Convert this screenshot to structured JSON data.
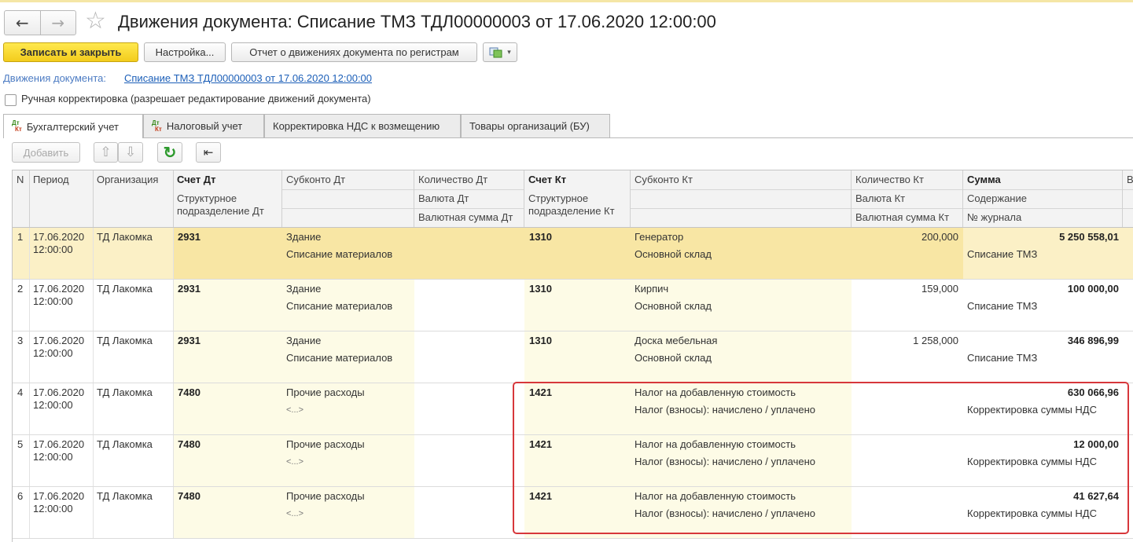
{
  "window": {
    "title": "Движения документа: Списание ТМЗ ТДЛ00000003 от 17.06.2020 12:00:00",
    "back_icon": "←",
    "forward_icon": "→",
    "star_icon": "☆"
  },
  "toolbar": {
    "save_close": "Записать и закрыть",
    "settings": "Настройка...",
    "report": "Отчет о движениях документа по регистрам",
    "more_icon": "▾"
  },
  "doc": {
    "label": "Движения документа:",
    "link": "Списание ТМЗ ТДЛ00000003 от 17.06.2020 12:00:00"
  },
  "manual": {
    "label": "Ручная корректировка (разрешает редактирование движений документа)",
    "checked": false
  },
  "tabs": [
    {
      "label": "Бухгалтерский учет",
      "icon_top": "Дт",
      "icon_bottom": "Кт",
      "active": true
    },
    {
      "label": "Налоговый учет",
      "icon_top": "Дт",
      "icon_bottom": "Кт",
      "active": false
    },
    {
      "label": "Корректировка НДС к возмещению",
      "active": false
    },
    {
      "label": "Товары организаций (БУ)",
      "active": false
    }
  ],
  "table_toolbar": {
    "add": "Добавить",
    "up_icon": "⇧",
    "down_icon": "⇩",
    "refresh_icon": "↻",
    "register_icon": "⇤"
  },
  "columns": {
    "n": "N",
    "period": "Период",
    "org": "Организация",
    "acc_dt": "Счет Дт",
    "dept_dt": "Структурное подразделение Дт",
    "sub_dt": "Субконто Дт",
    "qty_dt": "Количество Дт",
    "cur_dt": "Валюта Дт",
    "cursum_dt": "Валютная сумма Дт",
    "acc_kt": "Счет Кт",
    "dept_kt": "Структурное подразделение Кт",
    "sub_kt": "Субконто Кт",
    "qty_kt": "Количество Кт",
    "cur_kt": "Валюта Кт",
    "cursum_kt": "Валютная сумма Кт",
    "sum": "Сумма",
    "content": "Содержание",
    "journal": "№ журнала",
    "extra": "В"
  },
  "rows": [
    {
      "n": "1",
      "date": "17.06.2020",
      "time": "12:00:00",
      "org": "ТД Лакомка",
      "acc_dt": "2931",
      "sub_dt_1": "Здание",
      "sub_dt_2": "Списание материалов",
      "acc_kt": "1310",
      "sub_kt_1": "Генератор",
      "sub_kt_2": "Основной склад",
      "qty_kt": "200,000",
      "sum": "5 250 558,01",
      "content": "Списание ТМЗ"
    },
    {
      "n": "2",
      "date": "17.06.2020",
      "time": "12:00:00",
      "org": "ТД Лакомка",
      "acc_dt": "2931",
      "sub_dt_1": "Здание",
      "sub_dt_2": "Списание материалов",
      "acc_kt": "1310",
      "sub_kt_1": "Кирпич",
      "sub_kt_2": "Основной склад",
      "qty_kt": "159,000",
      "sum": "100 000,00",
      "content": "Списание ТМЗ"
    },
    {
      "n": "3",
      "date": "17.06.2020",
      "time": "12:00:00",
      "org": "ТД Лакомка",
      "acc_dt": "2931",
      "sub_dt_1": "Здание",
      "sub_dt_2": "Списание материалов",
      "acc_kt": "1310",
      "sub_kt_1": "Доска мебельная",
      "sub_kt_2": "Основной склад",
      "qty_kt": "1 258,000",
      "sum": "346 896,99",
      "content": "Списание ТМЗ"
    },
    {
      "n": "4",
      "date": "17.06.2020",
      "time": "12:00:00",
      "org": "ТД Лакомка",
      "acc_dt": "7480",
      "sub_dt_1": "Прочие расходы",
      "sub_dt_2": "<...>",
      "acc_kt": "1421",
      "sub_kt_1": "Налог на добавленную стоимость",
      "sub_kt_2": "Налог (взносы): начислено / уплачено",
      "qty_kt": "",
      "sum": "630 066,96",
      "content": "Корректировка суммы НДС"
    },
    {
      "n": "5",
      "date": "17.06.2020",
      "time": "12:00:00",
      "org": "ТД Лакомка",
      "acc_dt": "7480",
      "sub_dt_1": "Прочие расходы",
      "sub_dt_2": "<...>",
      "acc_kt": "1421",
      "sub_kt_1": "Налог на добавленную стоимость",
      "sub_kt_2": "Налог (взносы): начислено / уплачено",
      "qty_kt": "",
      "sum": "12 000,00",
      "content": "Корректировка суммы НДС"
    },
    {
      "n": "6",
      "date": "17.06.2020",
      "time": "12:00:00",
      "org": "ТД Лакомка",
      "acc_dt": "7480",
      "sub_dt_1": "Прочие расходы",
      "sub_dt_2": "<...>",
      "acc_kt": "1421",
      "sub_kt_1": "Налог на добавленную стоимость",
      "sub_kt_2": "Налог (взносы): начислено / уплачено",
      "qty_kt": "",
      "sum": "41 627,64",
      "content": "Корректировка суммы НДС"
    }
  ],
  "colors": {
    "accent": "#f3cc1c",
    "link": "#1c5fb8",
    "selected_row": "#fbf0c6",
    "edit_cell": "#fdfbe6",
    "highlight_box": "#d7373b"
  }
}
